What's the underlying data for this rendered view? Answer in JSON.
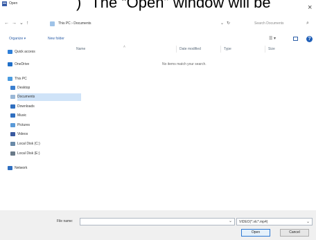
{
  "caption": {
    "number": ")",
    "text": "The “Open” window will be"
  },
  "window": {
    "title": "Open",
    "close_glyph": "×",
    "icon": "dialog-app-icon"
  },
  "navigation": {
    "back": "←",
    "forward": "→",
    "recent": "⌄",
    "up": "↑",
    "path": "This PC › Documents",
    "dropdown": "⌄",
    "refresh": "↻",
    "search_placeholder": "Search Documents",
    "search_glyph": "⌕"
  },
  "toolbar": {
    "organize": "Organize ▾",
    "new_folder": "New folder",
    "view": "☰ ▾",
    "help": "?"
  },
  "sidebar": {
    "items": [
      {
        "label": "Quick access",
        "icon": "star-icon",
        "color": "#2f7fd8",
        "indent": 0
      },
      {
        "label": "OneDrive",
        "icon": "cloud-icon",
        "color": "#1f6fc9",
        "indent": 0
      },
      {
        "label": "This PC",
        "icon": "computer-icon",
        "color": "#4a9be0",
        "indent": 0
      },
      {
        "label": "Desktop",
        "icon": "desktop-icon",
        "color": "#3a7fd0",
        "indent": 1
      },
      {
        "label": "Documents",
        "icon": "documents-icon",
        "color": "#9ab8d8",
        "indent": 1,
        "selected": true
      },
      {
        "label": "Downloads",
        "icon": "downloads-icon",
        "color": "#2f6fc0",
        "indent": 1
      },
      {
        "label": "Music",
        "icon": "music-icon",
        "color": "#2f6fc0",
        "indent": 1
      },
      {
        "label": "Pictures",
        "icon": "pictures-icon",
        "color": "#5a9ad8",
        "indent": 1
      },
      {
        "label": "Videos",
        "icon": "videos-icon",
        "color": "#3a5aa0",
        "indent": 1
      },
      {
        "label": "Local Disk (C:)",
        "icon": "disk-icon",
        "color": "#6a8aa8",
        "indent": 1
      },
      {
        "label": "Local Disk (E:)",
        "icon": "disk-icon",
        "color": "#6a7a88",
        "indent": 1
      },
      {
        "label": "Network",
        "icon": "network-icon",
        "color": "#2f6fc0",
        "indent": 0
      }
    ]
  },
  "file_list": {
    "columns": [
      "Name",
      "Date modified",
      "Type",
      "Size"
    ],
    "sort_glyph": "˄",
    "empty_message": "No items match your search."
  },
  "footer": {
    "file_name_label": "File name:",
    "file_name_value": "",
    "file_name_dropdown": "⌄",
    "filter_value": "VIDEO(*.vlc*.mp4)",
    "filter_dropdown": "⌄",
    "open_label": "Open",
    "cancel_label": "Cancel"
  },
  "colors": {
    "accent": "#2b78d4",
    "selection": "#cfe3f8",
    "link": "#2d5fa8"
  }
}
